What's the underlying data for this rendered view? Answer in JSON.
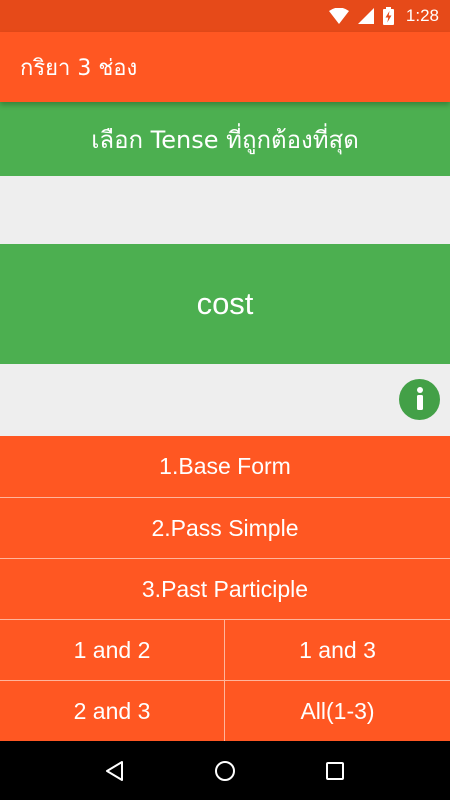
{
  "status_bar": {
    "time": "1:28",
    "icons": [
      "wifi-icon",
      "cell-signal-icon",
      "battery-charging-icon"
    ],
    "color": "#e64a19"
  },
  "app_bar": {
    "title": "กริยา 3 ช่อง",
    "color": "#ff5722"
  },
  "prompt": {
    "text": "เลือก Tense ที่ถูกต้องที่สุด",
    "color": "#4caf50"
  },
  "word": {
    "text": "cost"
  },
  "info_button": {
    "icon": "info-icon",
    "color": "#43a047"
  },
  "options": [
    {
      "label": "1.Base Form"
    },
    {
      "label": "2.Pass Simple"
    },
    {
      "label": "3.Past Participle"
    },
    {
      "label": "1 and 2"
    },
    {
      "label": "1 and 3"
    },
    {
      "label": "2 and 3"
    },
    {
      "label": "All(1-3)"
    }
  ],
  "nav_bar": {
    "buttons": [
      "back-icon",
      "home-icon",
      "recents-icon"
    ]
  }
}
